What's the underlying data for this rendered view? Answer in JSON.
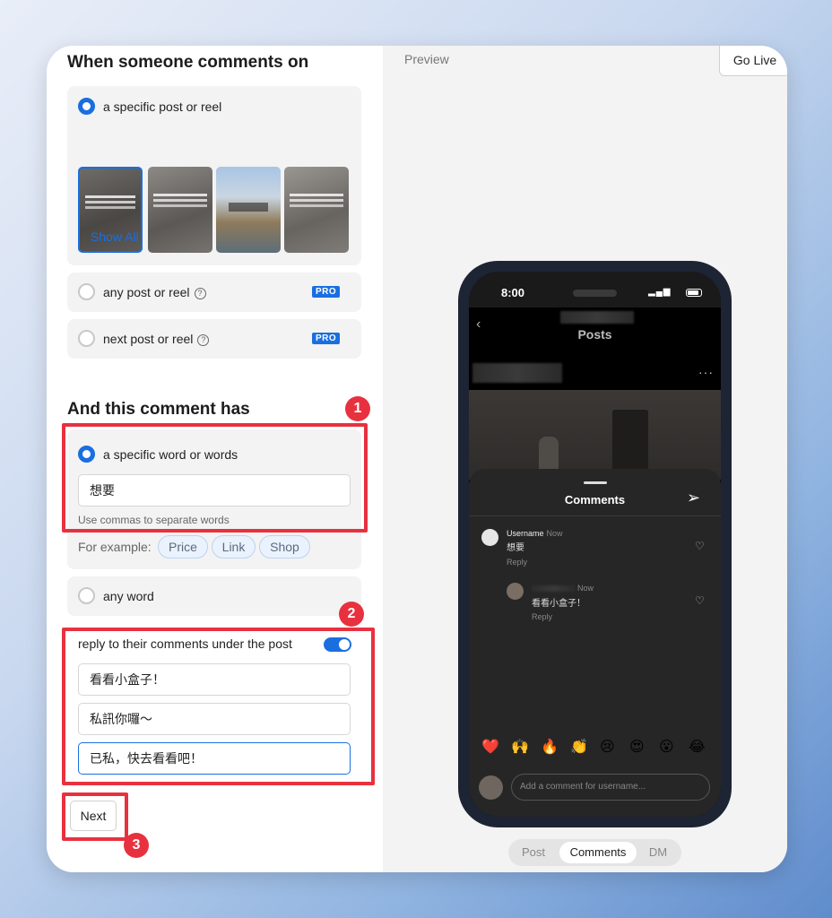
{
  "section1": {
    "title": "When someone comments on",
    "option_specific": "a specific post or reel",
    "show_all": "Show All",
    "option_any": "any post or reel",
    "option_next": "next post or reel",
    "pro_badge": "PRO",
    "help_glyph": "?"
  },
  "section2": {
    "title": "And this comment has",
    "option_specific": "a specific word or words",
    "keyword_value": "想要",
    "hint": "Use commas to separate words",
    "example_label": "For example:",
    "examples": [
      "Price",
      "Link",
      "Shop"
    ],
    "option_any": "any word"
  },
  "reply": {
    "label": "reply to their comments under the post",
    "toggle_on": true,
    "replies": [
      "看看小盒子！",
      "私訊你囉～",
      "已私，快去看看吧！"
    ]
  },
  "next_button": "Next",
  "markers": [
    "1",
    "2",
    "3"
  ],
  "preview": {
    "label": "Preview",
    "go_live": "Go Live",
    "phone": {
      "time": "8:00",
      "signal": "▂▄▆",
      "back_glyph": "‹",
      "header_title": "Posts",
      "more_glyph": "···",
      "sheet_title": "Comments",
      "send_glyph": "➢",
      "comment_username": "Username",
      "comment_time": "Now",
      "comment_text": "想要",
      "reply_label": "Reply",
      "reply_time": "Now",
      "reply_text": "看看小盒子！",
      "heart_glyph": "♡",
      "emojis": [
        "❤️",
        "🙌",
        "🔥",
        "👏",
        "😢",
        "😍",
        "😮",
        "😂"
      ],
      "add_comment_placeholder": "Add a comment for username..."
    },
    "tabs": [
      "Post",
      "Comments",
      "DM"
    ],
    "active_tab": "Comments"
  },
  "colors": {
    "accent": "#1a6fe0",
    "highlight": "#e8313f"
  }
}
